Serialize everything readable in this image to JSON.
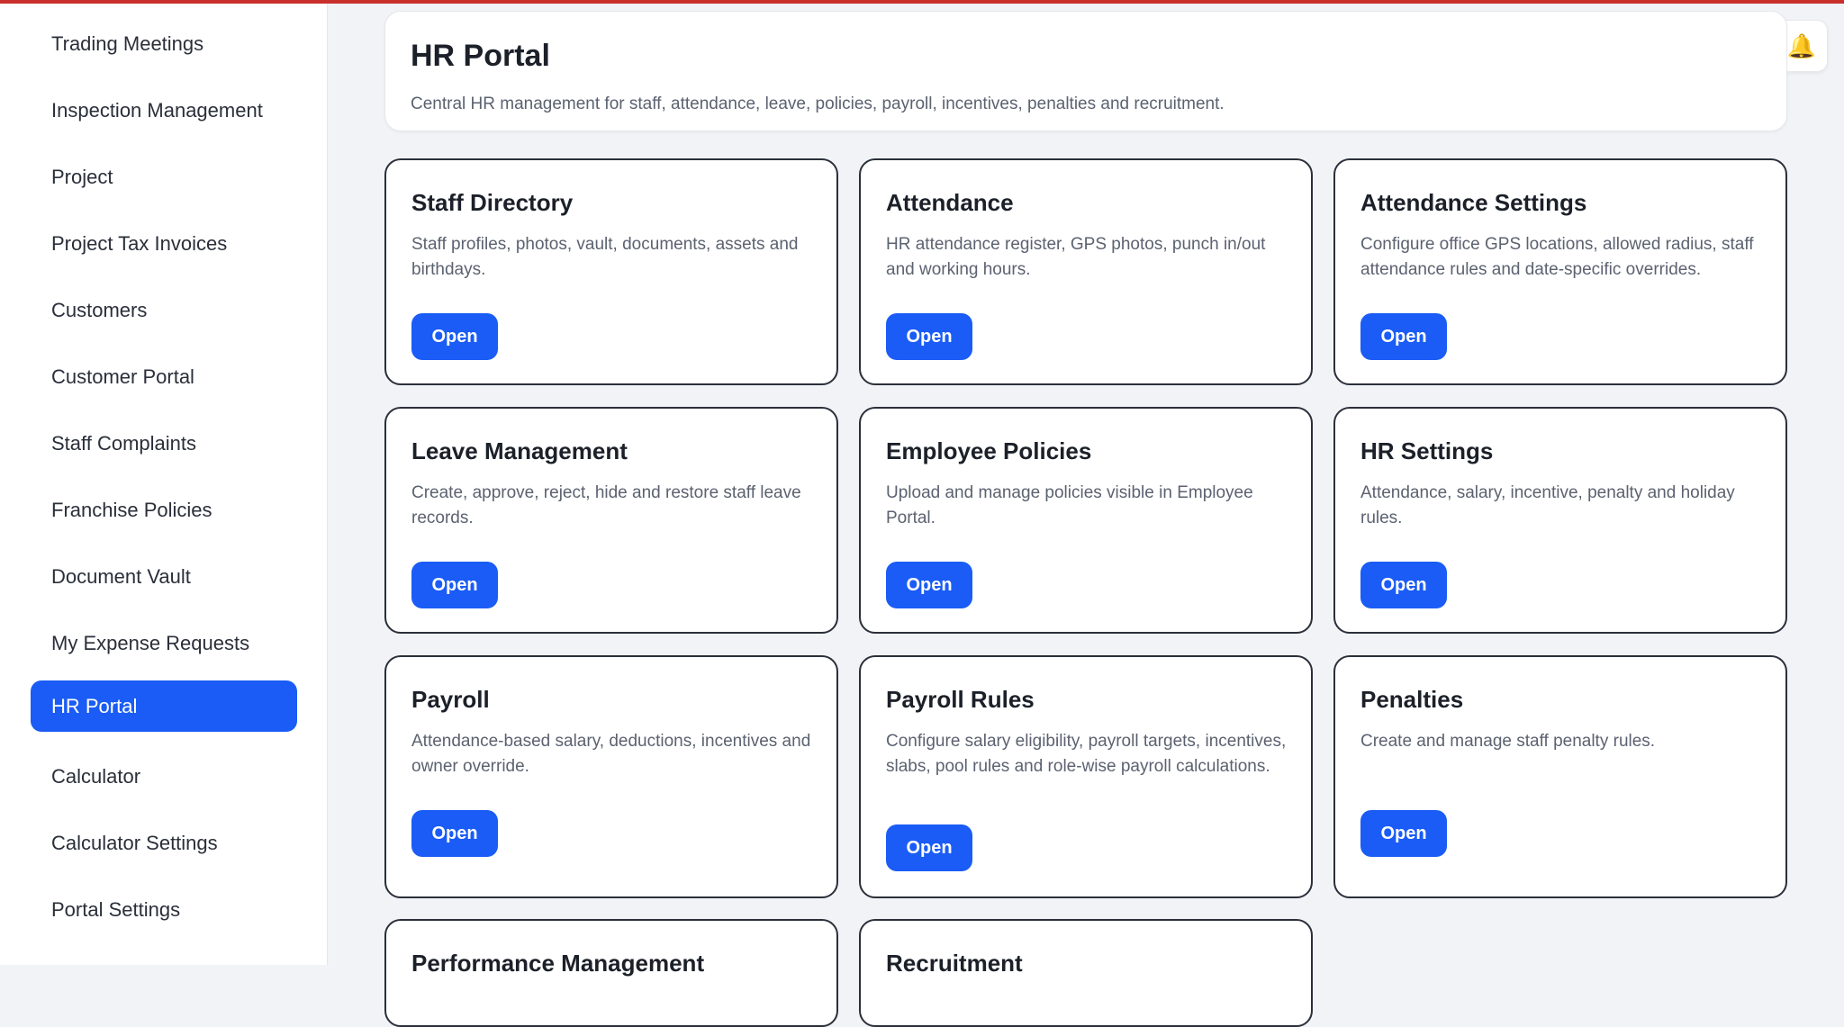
{
  "sidebar": {
    "items": [
      {
        "label": "Trading Meetings",
        "active": false
      },
      {
        "label": "Inspection Management",
        "active": false
      },
      {
        "label": "Project",
        "active": false
      },
      {
        "label": "Project Tax Invoices",
        "active": false
      },
      {
        "label": "Customers",
        "active": false
      },
      {
        "label": "Customer Portal",
        "active": false
      },
      {
        "label": "Staff Complaints",
        "active": false
      },
      {
        "label": "Franchise Policies",
        "active": false
      },
      {
        "label": "Document Vault",
        "active": false
      },
      {
        "label": "My Expense Requests",
        "active": false
      },
      {
        "label": "HR Portal",
        "active": true
      },
      {
        "label": "Calculator",
        "active": false
      },
      {
        "label": "Calculator Settings",
        "active": false
      },
      {
        "label": "Portal Settings",
        "active": false
      }
    ]
  },
  "header": {
    "title": "HR Portal",
    "subtitle": "Central HR management for staff, attendance, leave, policies, payroll, incentives, penalties and recruitment."
  },
  "notification": {
    "icon": "bell-icon"
  },
  "cards": [
    {
      "title": "Staff Directory",
      "description": "Staff profiles, photos, vault, documents, assets and birthdays.",
      "button": "Open"
    },
    {
      "title": "Attendance",
      "description": "HR attendance register, GPS photos, punch in/out and working hours.",
      "button": "Open"
    },
    {
      "title": "Attendance Settings",
      "description": "Configure office GPS locations, allowed radius, staff attendance rules and date-specific overrides.",
      "button": "Open"
    },
    {
      "title": "Leave Management",
      "description": "Create, approve, reject, hide and restore staff leave records.",
      "button": "Open"
    },
    {
      "title": "Employee Policies",
      "description": "Upload and manage policies visible in Employee Portal.",
      "button": "Open"
    },
    {
      "title": "HR Settings",
      "description": "Attendance, salary, incentive, penalty and holiday rules.",
      "button": "Open"
    },
    {
      "title": "Payroll",
      "description": "Attendance-based salary, deductions, incentives and owner override.",
      "button": "Open"
    },
    {
      "title": "Payroll Rules",
      "description": "Configure salary eligibility, payroll targets, incentives, slabs, pool rules and role-wise payroll calculations.",
      "button": "Open"
    },
    {
      "title": "Penalties",
      "description": "Create and manage staff penalty rules.",
      "button": "Open"
    },
    {
      "title": "Performance Management",
      "description": "",
      "button": ""
    },
    {
      "title": "Recruitment",
      "description": "",
      "button": ""
    }
  ],
  "colors": {
    "accent": "#1a5cf5",
    "top_bar": "#c9302c"
  }
}
